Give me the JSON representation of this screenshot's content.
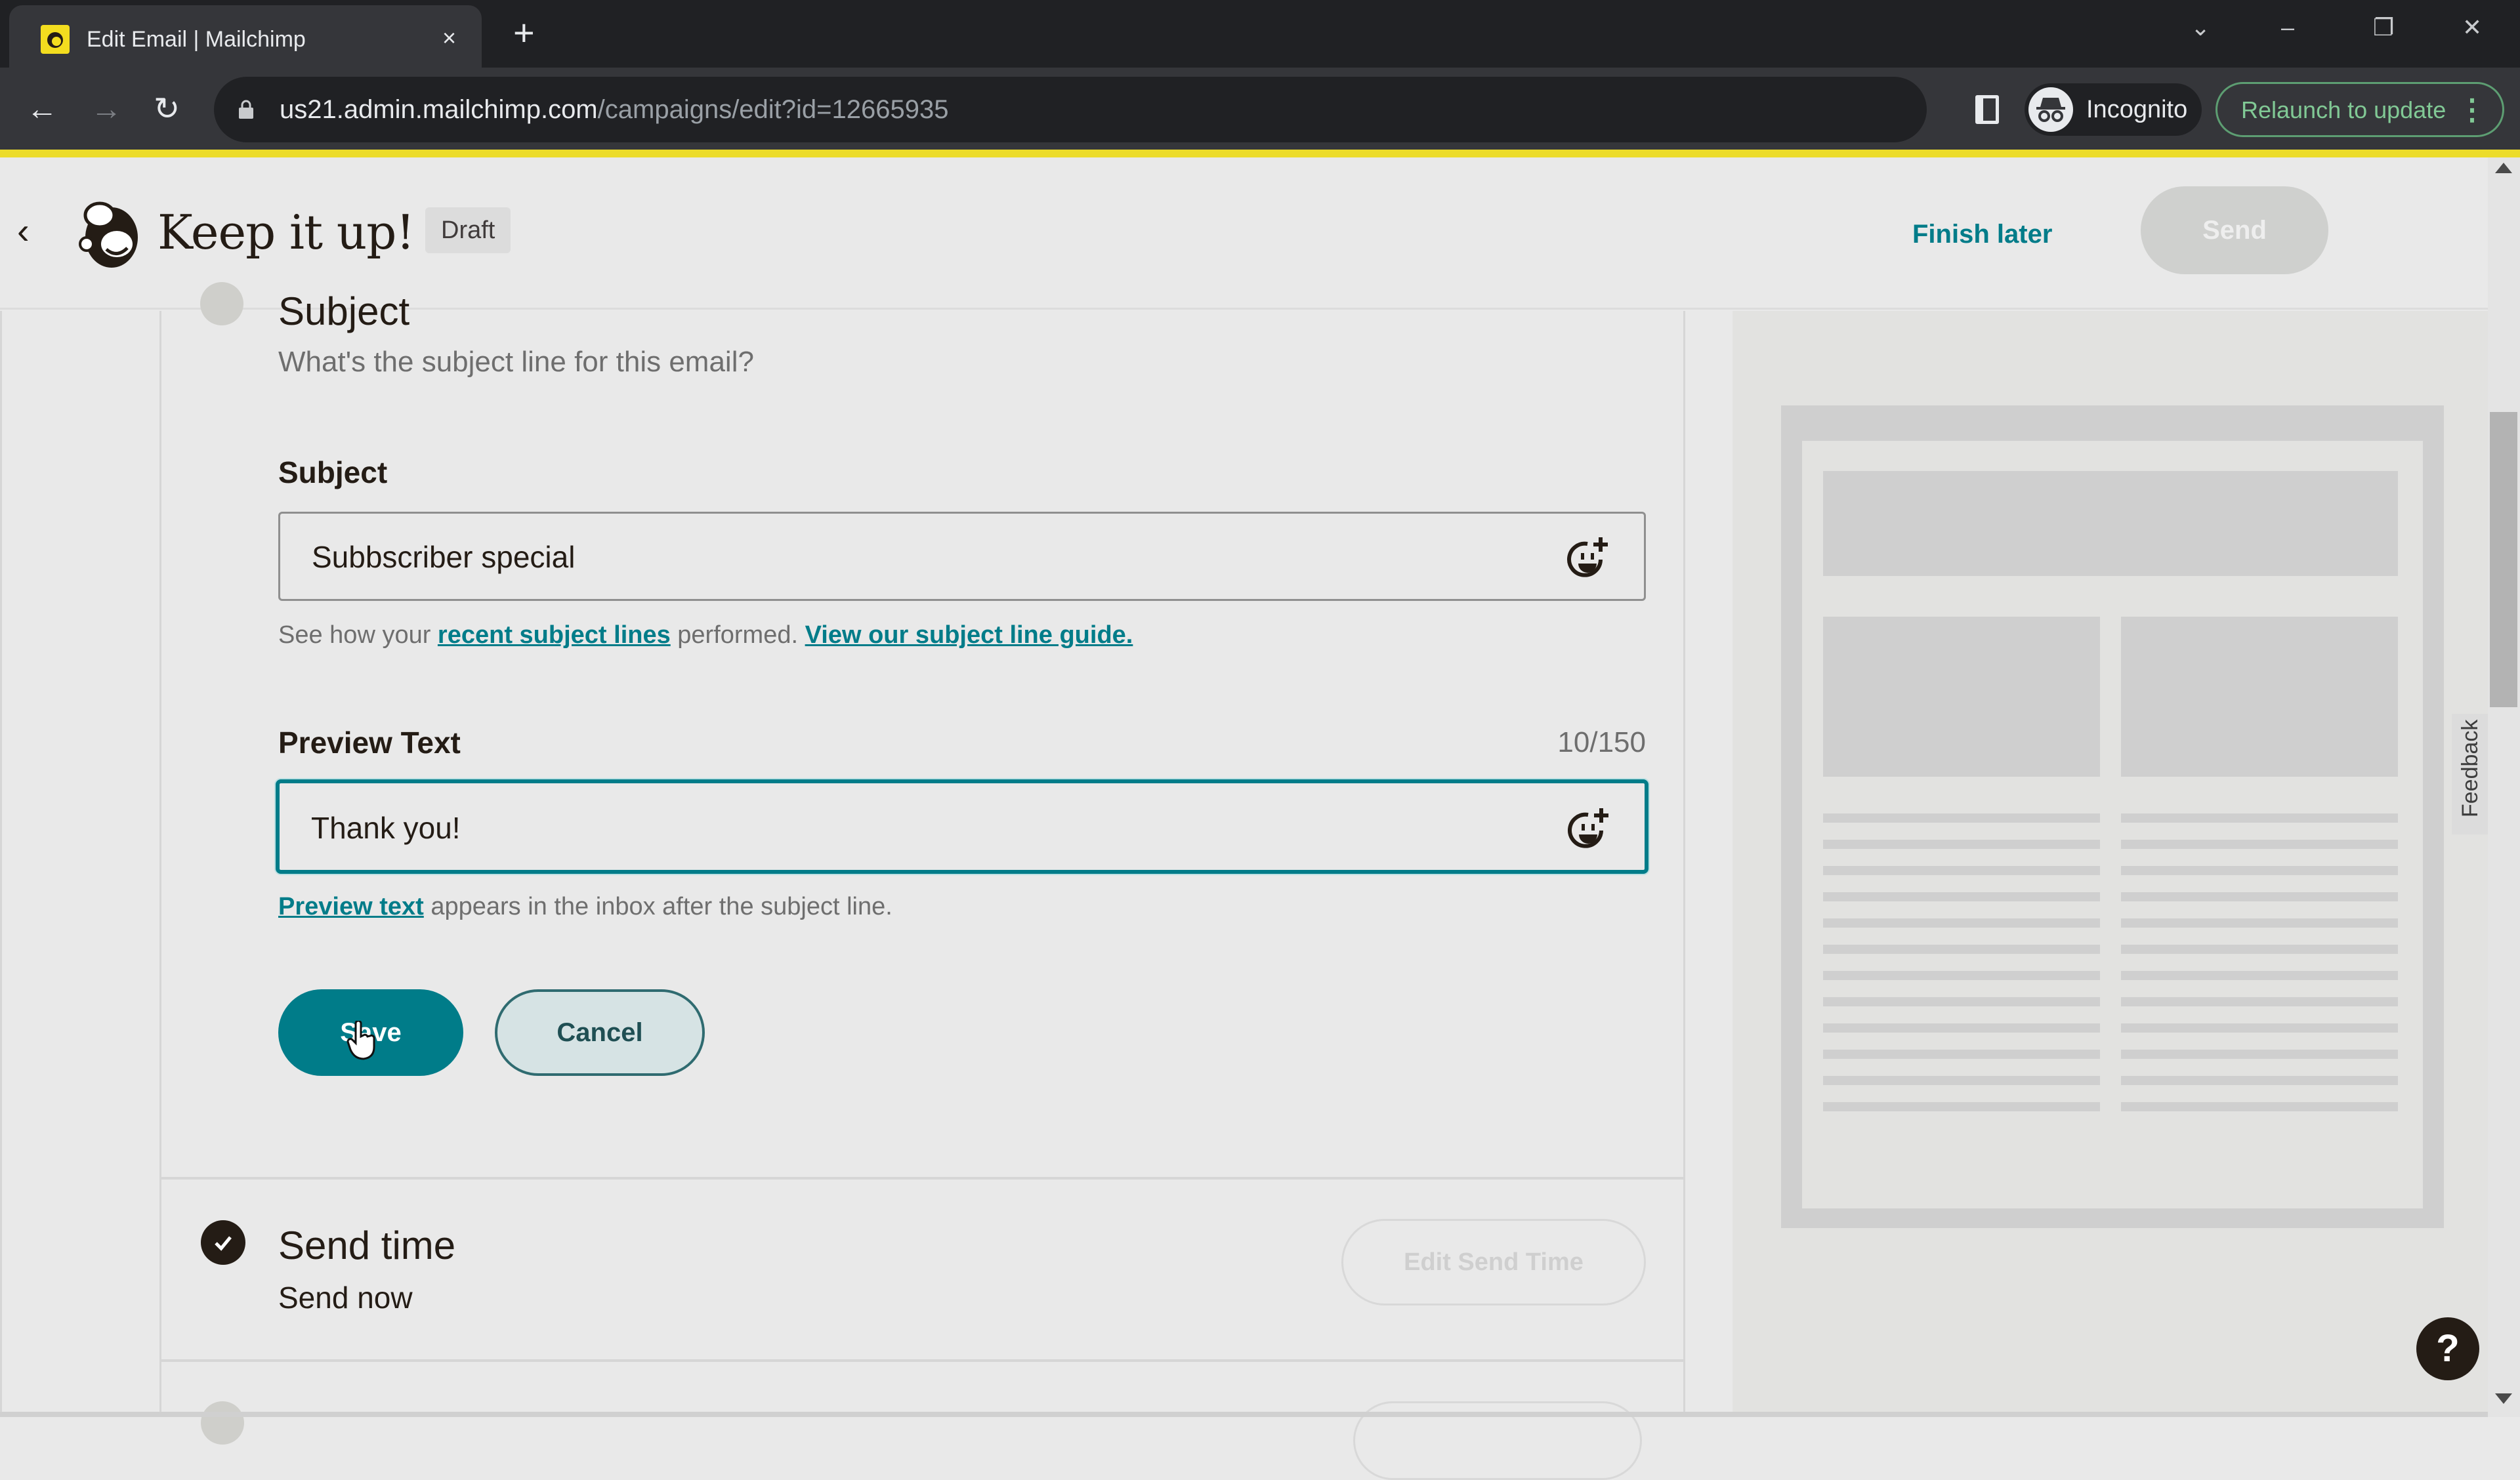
{
  "browser": {
    "tab_title": "Edit Email | Mailchimp",
    "tab_close": "×",
    "new_tab": "+",
    "url_domain": "us21.admin.mailchimp.com",
    "url_path": "/campaigns/edit?id=12665935",
    "profile_label": "Incognito",
    "relaunch_label": "Relaunch to update",
    "window_controls": {
      "tab_search": "⌄",
      "minimize": "–",
      "restore": "❐",
      "close": "✕"
    },
    "nav": {
      "back": "←",
      "forward": "→",
      "reload": "↻"
    }
  },
  "header": {
    "back": "‹",
    "title": "Keep it up!",
    "status_badge": "Draft",
    "finish_later": "Finish later",
    "send": "Send"
  },
  "subject_section": {
    "heading": "Subject",
    "description": "What's the subject line for this email?",
    "subject_label": "Subject",
    "subject_value": "Subbscriber special",
    "help_prefix": "See how your ",
    "help_link_1": "recent subject lines",
    "help_middle": " performed. ",
    "help_link_2": "View our subject line guide.",
    "preview_label": "Preview Text",
    "preview_count": "10/150",
    "preview_value": "Thank you!",
    "preview_help_link": "Preview text",
    "preview_help_rest": " appears in the inbox after the subject line.",
    "save": "Save",
    "cancel": "Cancel"
  },
  "send_time_section": {
    "heading": "Send time",
    "value": "Send now",
    "edit_button": "Edit Send Time",
    "completed": true
  },
  "preview_panel": {
    "feedback_label": "Feedback",
    "help": "?"
  },
  "colors": {
    "brand_teal": "#007c89",
    "chrome_dark": "#202124",
    "notice_yellow": "#ecdc2a",
    "relaunch_green": "#81c995"
  }
}
